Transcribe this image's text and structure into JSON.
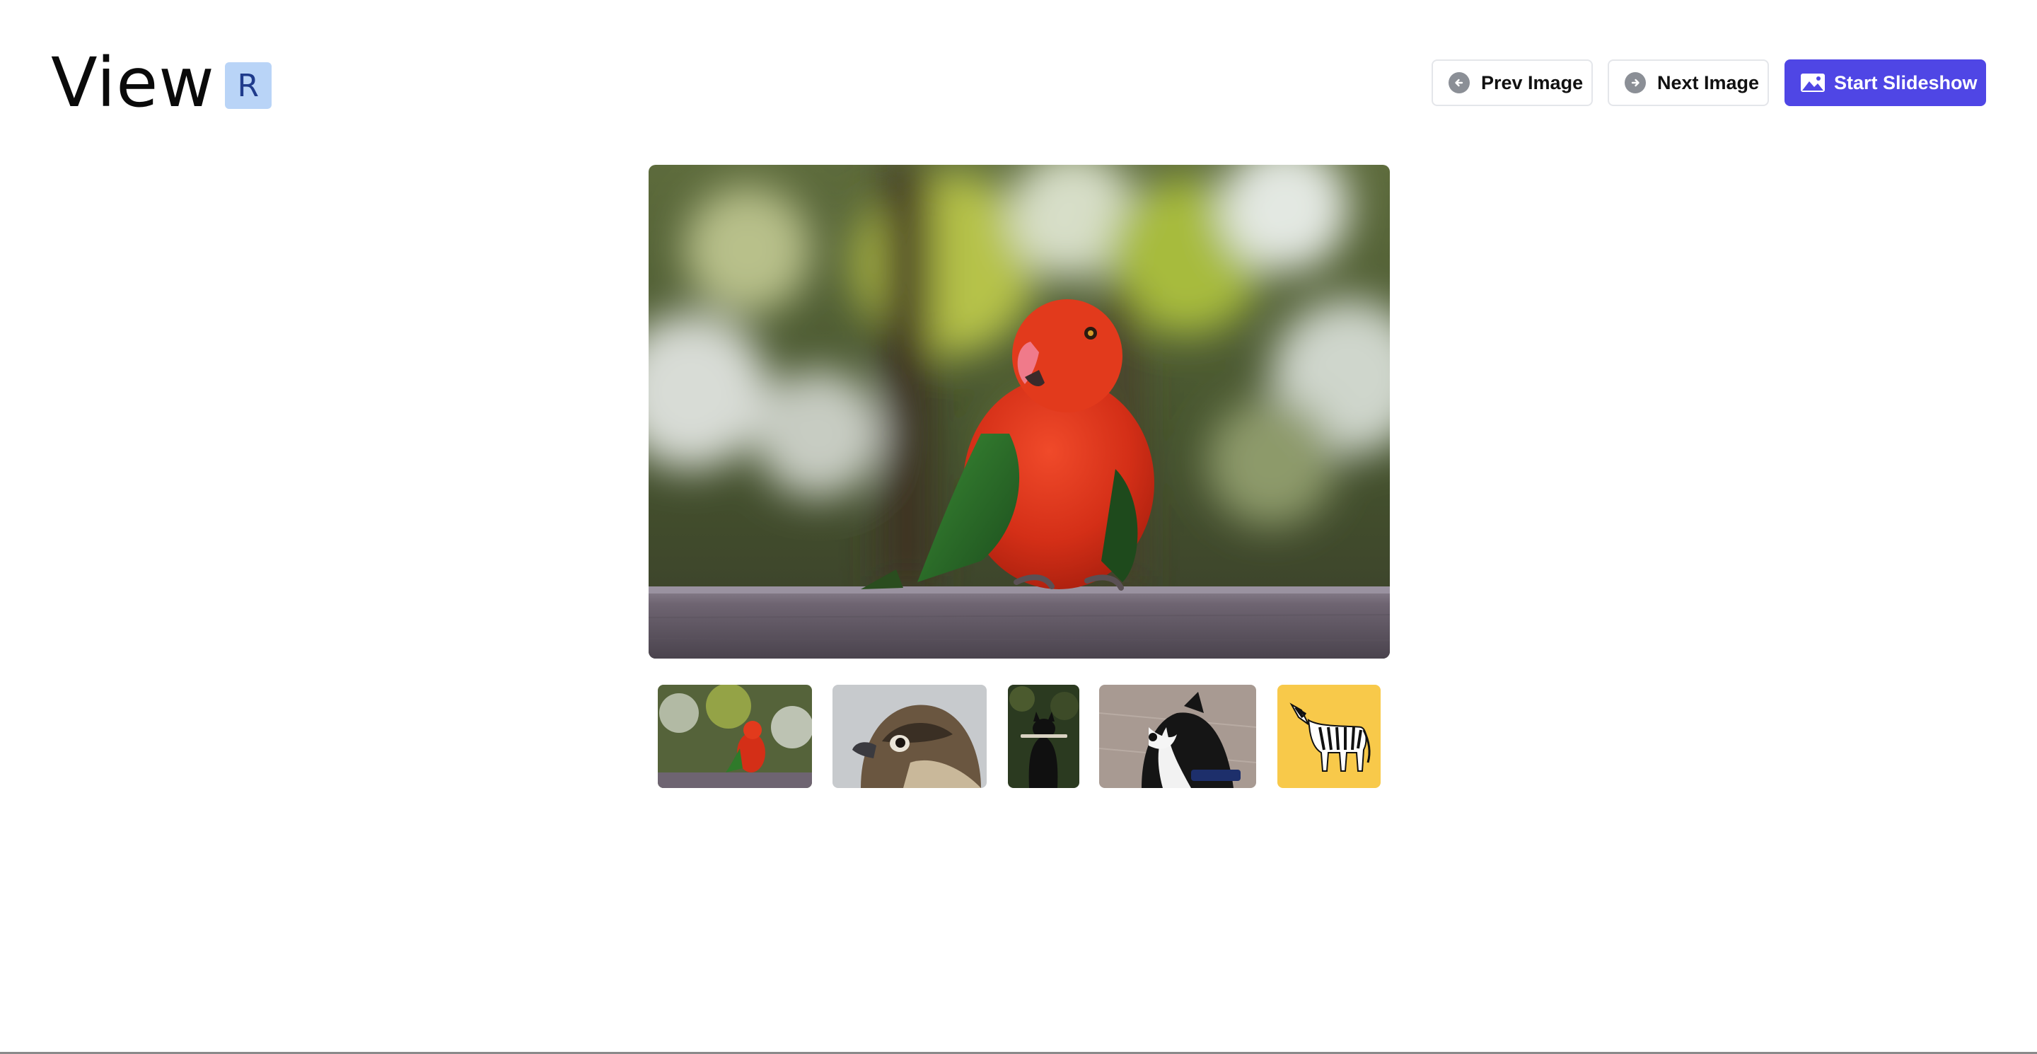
{
  "header": {
    "logo_text": "View",
    "logo_badge": "R"
  },
  "toolbar": {
    "prev_label": "Prev Image",
    "next_label": "Next Image",
    "slideshow_label": "Start Slideshow"
  },
  "colors": {
    "accent": "#4f46e5",
    "badge_bg": "#b9d4f7",
    "badge_text": "#1f3b8c"
  },
  "gallery": {
    "selected_index": 0,
    "thumbnails": [
      {
        "subject": "parrot-photo"
      },
      {
        "subject": "falcon-photo"
      },
      {
        "subject": "dog-with-stick-photo"
      },
      {
        "subject": "border-collie-photo"
      },
      {
        "subject": "zebra-illustration"
      }
    ]
  }
}
